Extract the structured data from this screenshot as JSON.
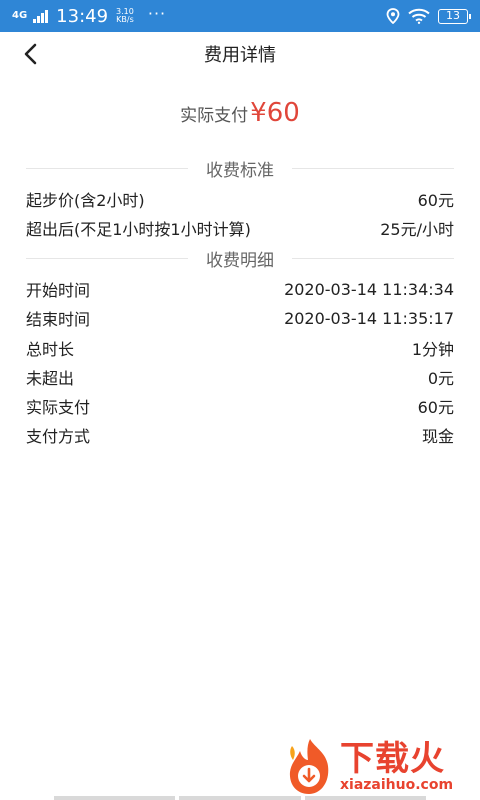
{
  "statusbar": {
    "network": "4G",
    "time": "13:49",
    "speed_value": "3.10",
    "speed_unit": "KB/s",
    "dots": "···",
    "battery": "13"
  },
  "navbar": {
    "title": "费用详情"
  },
  "amount": {
    "label": "实际支付",
    "value": "¥60",
    "color": "#e0463a"
  },
  "fee_standard": {
    "title": "收费标准",
    "rows": [
      {
        "label": "起步价(含2小时)",
        "value": "60元"
      },
      {
        "label": "超出后(不足1小时按1小时计算)",
        "value": "25元/小时"
      }
    ]
  },
  "fee_detail": {
    "title": "收费明细",
    "rows": [
      {
        "label": "开始时间",
        "value": "2020-03-14 11:34:34"
      },
      {
        "label": "结束时间",
        "value": "2020-03-14 11:35:17"
      },
      {
        "label": "总时长",
        "value": "1分钟"
      },
      {
        "label": "未超出",
        "value": "0元"
      },
      {
        "label": "实际支付",
        "value": "60元"
      },
      {
        "label": "支付方式",
        "value": "现金"
      }
    ]
  },
  "watermark": {
    "cn": "下载火",
    "en": "xiazaihuo.com"
  },
  "icons": {
    "back": "chevron-left-icon",
    "location": "location-icon",
    "wifi": "wifi-icon",
    "signal": "signal-icon",
    "battery": "battery-icon"
  },
  "colors": {
    "statusbar": "#2f86d6",
    "accent_red": "#e0463a"
  }
}
